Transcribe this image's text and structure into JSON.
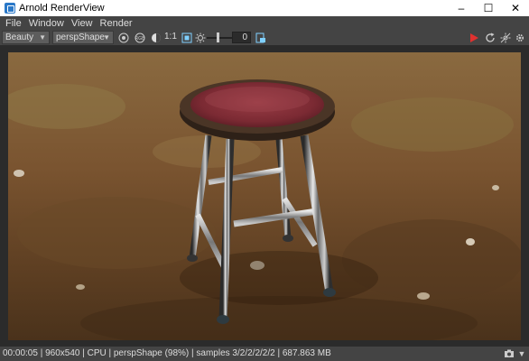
{
  "window": {
    "title": "Arnold RenderView",
    "minimize_glyph": "–",
    "maximize_glyph": "☐",
    "close_glyph": "✕"
  },
  "menu": [
    "File",
    "Window",
    "View",
    "Render"
  ],
  "toolbar": {
    "aov_value": "Beauty",
    "camera_value": "perspShape",
    "ratio_label": "1:1",
    "exposure_value": "0"
  },
  "status": {
    "text": "00:00:05 | 960x540 | CPU | perspShape (98%) | samples 3/2/2/2/2/2 | 687.863 MB"
  },
  "colors": {
    "render_button": "#e0312f",
    "ipr_icon": "#7fd0ff"
  }
}
